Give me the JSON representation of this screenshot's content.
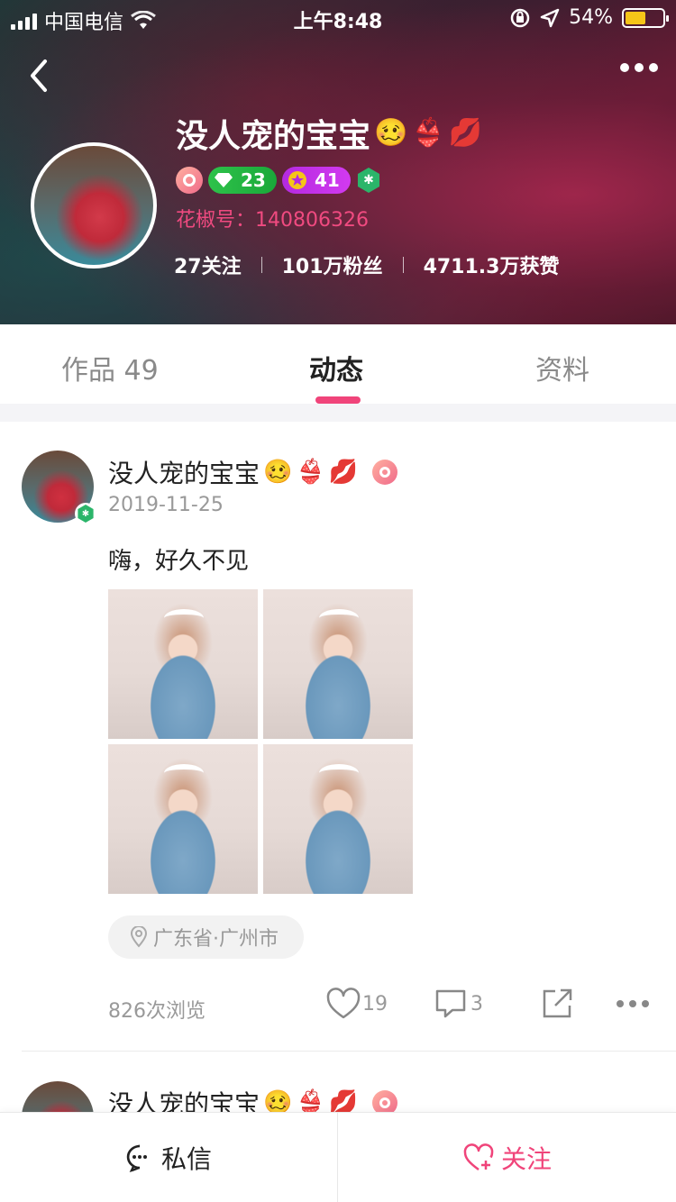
{
  "status_bar": {
    "carrier": "中国电信",
    "time": "上午8:48",
    "battery_percent": "54%",
    "battery_level": 0.54
  },
  "profile": {
    "name": "没人宠的宝宝",
    "name_emojis": [
      "🥴",
      "👙",
      "💋"
    ],
    "level_green": "23",
    "level_purple": "41",
    "huajiao_id": "花椒号：140806326",
    "stats": {
      "following": "27关注",
      "fans": "101万粉丝",
      "likes": "4711.3万获赞"
    }
  },
  "tabs": {
    "works": "作品 49",
    "moments": "动态",
    "info": "资料",
    "active": "moments"
  },
  "posts": [
    {
      "author": "没人宠的宝宝",
      "date": "2019-11-25",
      "text": "嗨，好久不见",
      "image_count": 4,
      "location": "广东省·广州市",
      "views": "826次浏览",
      "likes": "19",
      "comments": "3"
    },
    {
      "author": "没人宠的宝宝"
    }
  ],
  "bottom_bar": {
    "message": "私信",
    "follow": "关注"
  },
  "colors": {
    "accent": "#f0447a",
    "green_badge": "#2ec24a",
    "purple_badge": "#c030e8"
  }
}
